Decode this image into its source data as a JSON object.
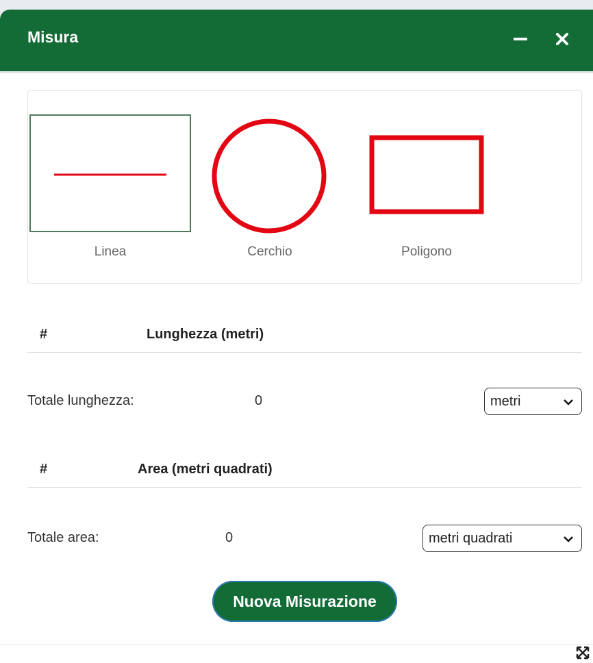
{
  "window": {
    "title": "Misura"
  },
  "shapes": [
    {
      "label": "Linea"
    },
    {
      "label": "Cerchio"
    },
    {
      "label": "Poligono"
    }
  ],
  "length_table": {
    "hash": "#",
    "column": "Lunghezza (metri)",
    "total_label": "Totale lunghezza:",
    "total_value": "0",
    "unit_selected": "metri"
  },
  "area_table": {
    "hash": "#",
    "column": "Area (metri quadrati)",
    "total_label": "Totale area:",
    "total_value": "0",
    "unit_selected": "metri quadrati"
  },
  "actions": {
    "new_measurement": "Nuova Misurazione"
  },
  "icons": {
    "minimize": "minimize-icon",
    "close": "close-icon",
    "resize": "resize-icon",
    "chevron": "chevron-down-icon"
  },
  "colors": {
    "header": "#136b36",
    "shape_stroke": "#e30613",
    "selected_border": "#4f7a5b"
  }
}
